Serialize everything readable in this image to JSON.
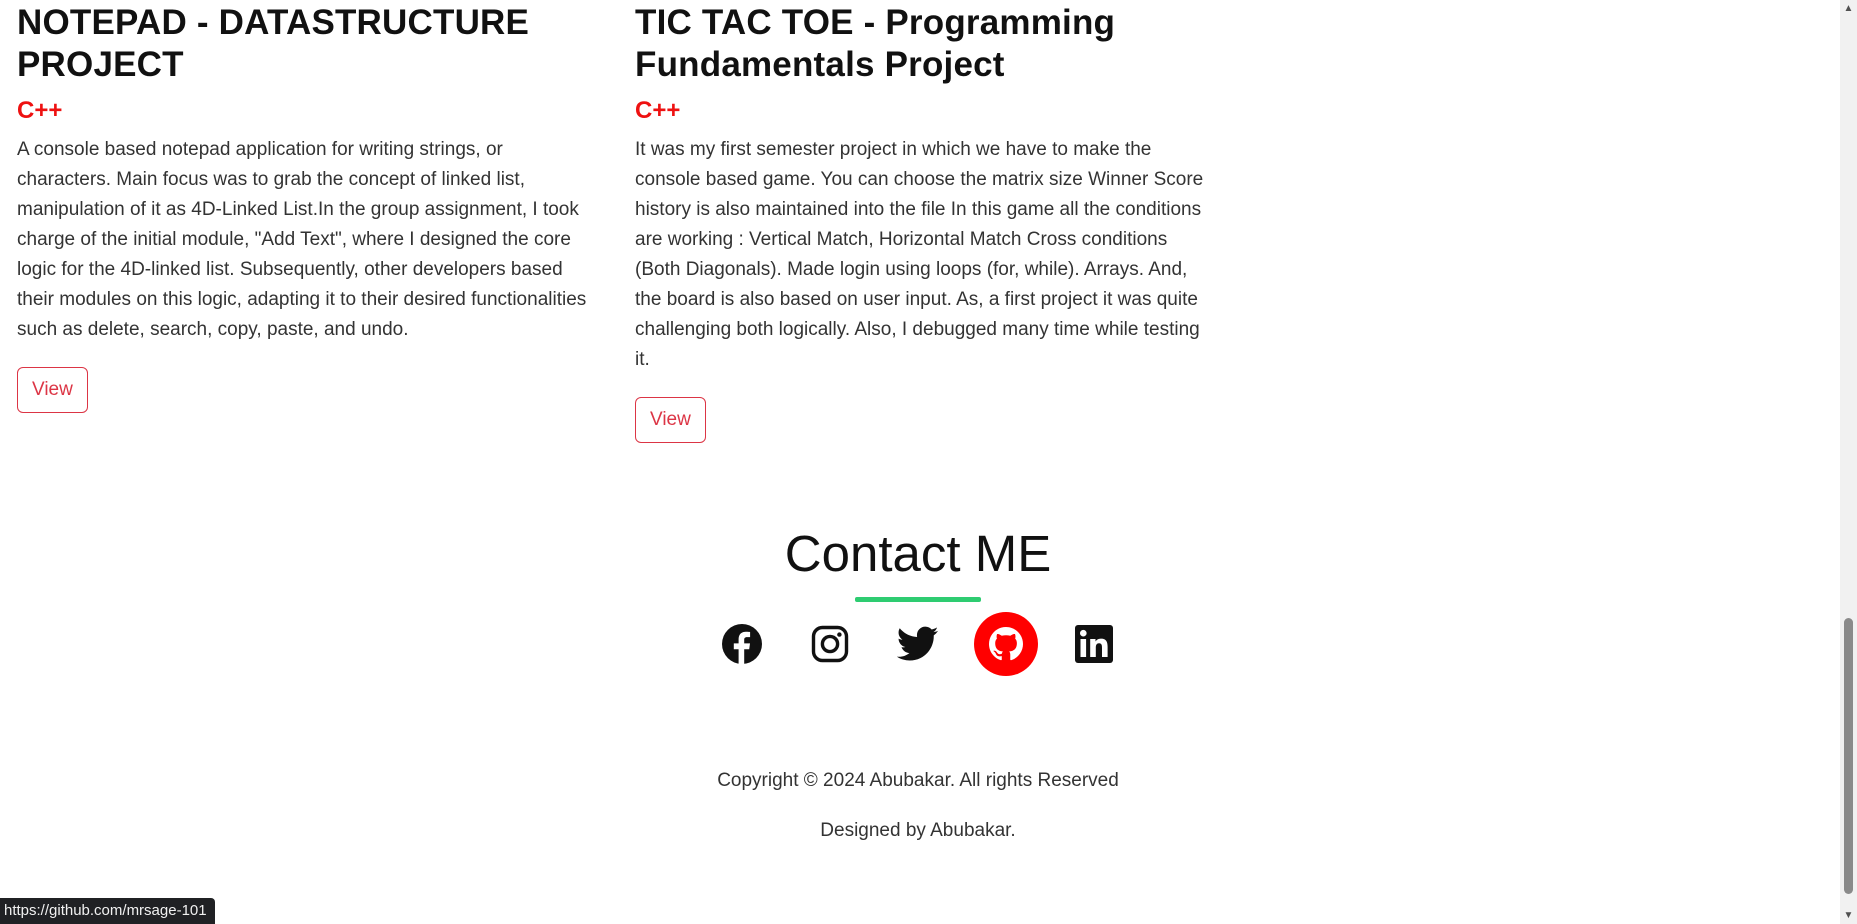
{
  "projects": [
    {
      "title": "NOTEPAD - DATASTRUCTURE PROJECT",
      "language": "C++",
      "description": "A console based notepad application for writing strings, or characters. Main focus was to grab the concept of linked list, manipulation of it as 4D-Linked List.In the group assignment, I took charge of the initial module, \"Add Text\", where I designed the core logic for the 4D-linked list. Subsequently, other developers based their modules on this logic, adapting it to their desired functionalities such as delete, search, copy, paste, and undo.",
      "button_label": "View"
    },
    {
      "title": "TIC TAC TOE - Programming Fundamentals Project",
      "language": "C++",
      "description": "It was my first semester project in which we have to make the console based game. You can choose the matrix size Winner Score history is also maintained into the file In this game all the conditions are working : Vertical Match, Horizontal Match Cross conditions (Both Diagonals). Made login using loops (for, while). Arrays. And, the board is also based on user input. As, a first project it was quite challenging both logically. Also, I debugged many time while testing it.",
      "button_label": "View"
    }
  ],
  "contact": {
    "title": "Contact ME",
    "accent_color": "#2ecc71",
    "socials": [
      {
        "name": "facebook",
        "icon": "facebook-icon",
        "active": false
      },
      {
        "name": "instagram",
        "icon": "instagram-icon",
        "active": false
      },
      {
        "name": "twitter",
        "icon": "twitter-icon",
        "active": false
      },
      {
        "name": "github",
        "icon": "github-icon",
        "active": true,
        "active_color": "#ff0000"
      },
      {
        "name": "linkedin",
        "icon": "linkedin-icon",
        "active": false
      }
    ]
  },
  "footer": {
    "copyright": "Copyright © 2024 Abubakar. All rights Reserved",
    "designed_by": "Designed by Abubakar."
  },
  "status_bar": {
    "url": "https://github.com/mrsage-101"
  },
  "colors": {
    "language": "#ee1111",
    "button": "#dc3545"
  }
}
